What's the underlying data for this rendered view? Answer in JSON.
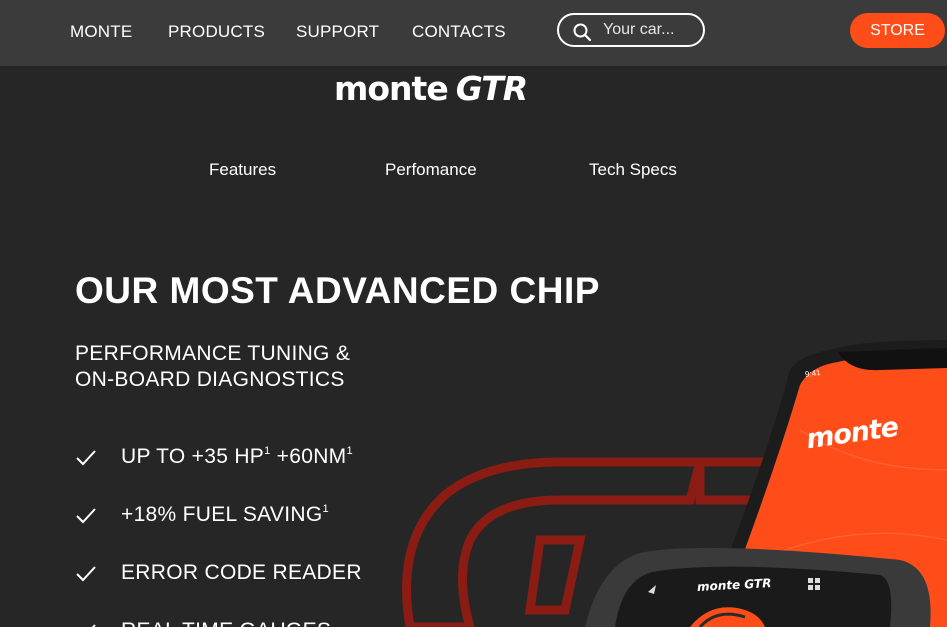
{
  "nav": {
    "items": [
      "MONTE",
      "PRODUCTS",
      "SUPPORT",
      "CONTACTS"
    ],
    "search_placeholder": "Your car...",
    "store_label": "STORE"
  },
  "logo": {
    "word1": "monte",
    "word2": "GTR"
  },
  "subnav": [
    "Features",
    "Perfomance",
    "Tech Specs"
  ],
  "hero": {
    "headline": "OUR MOST ADVANCED CHIP",
    "sub_line1": "PERFORMANCE TUNING &",
    "sub_line2": "ON-BOARD DIAGNOSTICS",
    "features": [
      {
        "text": "UP TO +35 HP",
        "sup": "1",
        "text2": " +60NM",
        "sup2": "1"
      },
      {
        "text": "+18% FUEL SAVING",
        "sup": "1"
      },
      {
        "text": "ERROR CODE READER"
      },
      {
        "text": "REAL TIME GAUGES"
      }
    ]
  },
  "phone": {
    "time": "9:41",
    "brand": "monte"
  },
  "device": {
    "brand": "monte GTR"
  },
  "colors": {
    "background": "#262626",
    "nav_bg": "#3b3b3b",
    "accent": "#ff4d1a",
    "outline_red": "#8a1c14"
  }
}
